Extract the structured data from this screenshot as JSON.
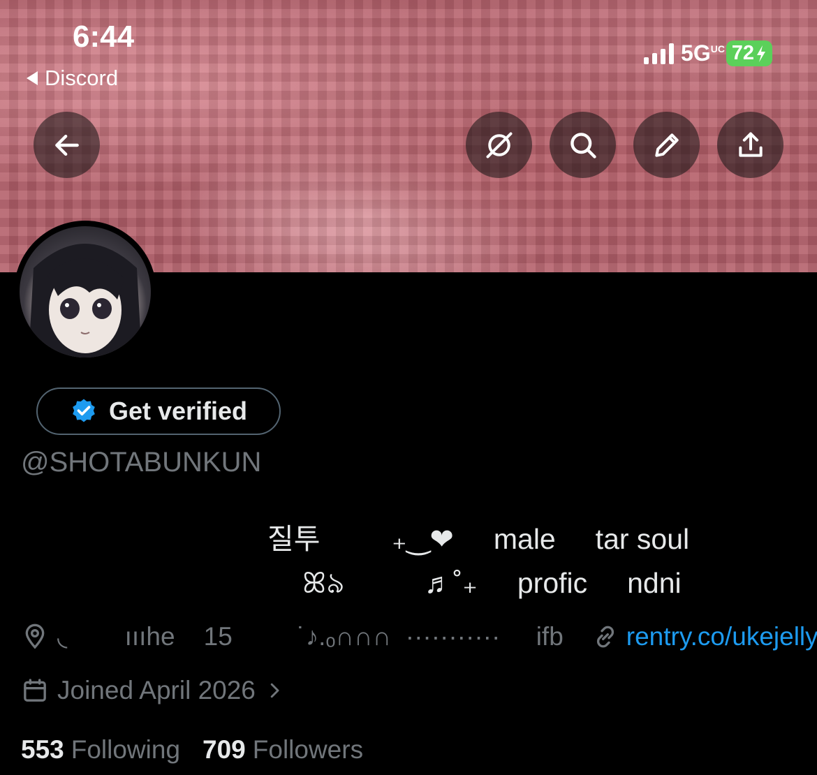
{
  "status_bar": {
    "time": "6:44",
    "back_app": "Discord",
    "network": "5G",
    "network_sup": "UC",
    "battery": "72"
  },
  "header_buttons": [
    {
      "name": "back-arrow-icon"
    },
    {
      "name": "grok-icon"
    },
    {
      "name": "search-icon"
    },
    {
      "name": "edit-icon"
    },
    {
      "name": "share-icon"
    }
  ],
  "profile": {
    "get_verified_label": "Get verified",
    "handle": "@SHOTABUNKUN",
    "bio_line1": "질투         ₊‿❤     male     tar soul",
    "bio_line2": "ꕤ৯          ♬˚₊     profic     ndni",
    "location": "◟        ıııhe    15         ˙♪.ₒ∩∩∩  ···········     ifb",
    "link": "rentry.co/ukejelly",
    "joined": "Joined April 2026",
    "following_count": "553",
    "following_label": "Following",
    "followers_count": "709",
    "followers_label": "Followers"
  },
  "colors": {
    "background": "#000000",
    "text_primary": "#e7e9ea",
    "text_secondary": "#71767b",
    "link": "#1d9bf0",
    "verified_badge": "#1d9bf0",
    "battery": "#5bd05a"
  }
}
